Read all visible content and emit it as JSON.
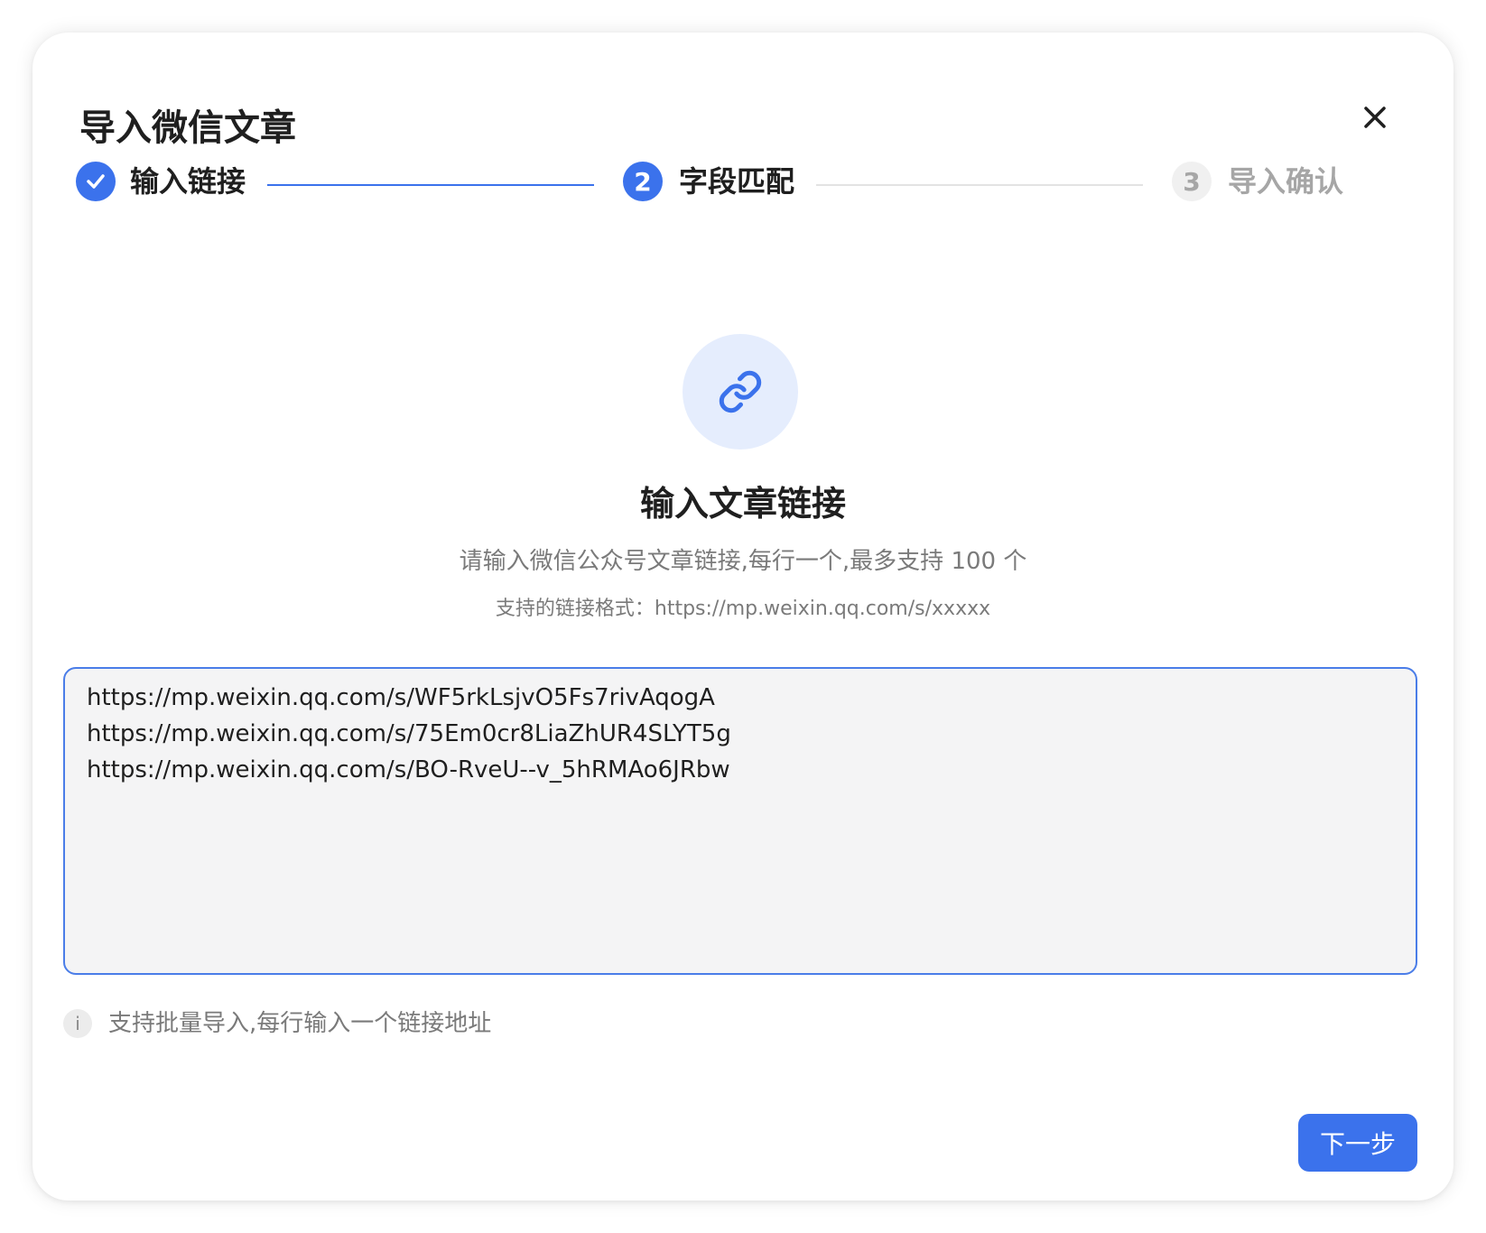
{
  "dialog": {
    "title": "导入微信文章",
    "close_icon": "close-icon"
  },
  "steps": [
    {
      "label": "输入链接",
      "status": "completed",
      "icon": "check-icon"
    },
    {
      "label": "字段匹配",
      "status": "active",
      "number": "2"
    },
    {
      "label": "导入确认",
      "status": "pending",
      "number": "3"
    }
  ],
  "content": {
    "icon": "link-icon",
    "heading": "输入文章链接",
    "description": "请输入微信公众号文章链接,每行一个,最多支持 100 个",
    "format_hint": "支持的链接格式：https://mp.weixin.qq.com/s/xxxxx"
  },
  "textarea": {
    "lines": [
      "https://mp.weixin.qq.com/s/WF5rkLsjvO5Fs7rivAqogA",
      "https://mp.weixin.qq.com/s/75Em0cr8LiaZhUR4SLYT5g",
      "https://mp.weixin.qq.com/s/BO-RveU--v_5hRMAo6JRbw"
    ]
  },
  "hint": {
    "icon_text": "i",
    "text": "支持批量导入,每行输入一个链接地址"
  },
  "footer": {
    "next_label": "下一步"
  },
  "colors": {
    "primary": "#3b72ec",
    "primary_light": "#e5edfd",
    "text_dark": "#1f1f1f",
    "text_muted": "#7a7a7a",
    "pending": "#a6a6a6"
  }
}
